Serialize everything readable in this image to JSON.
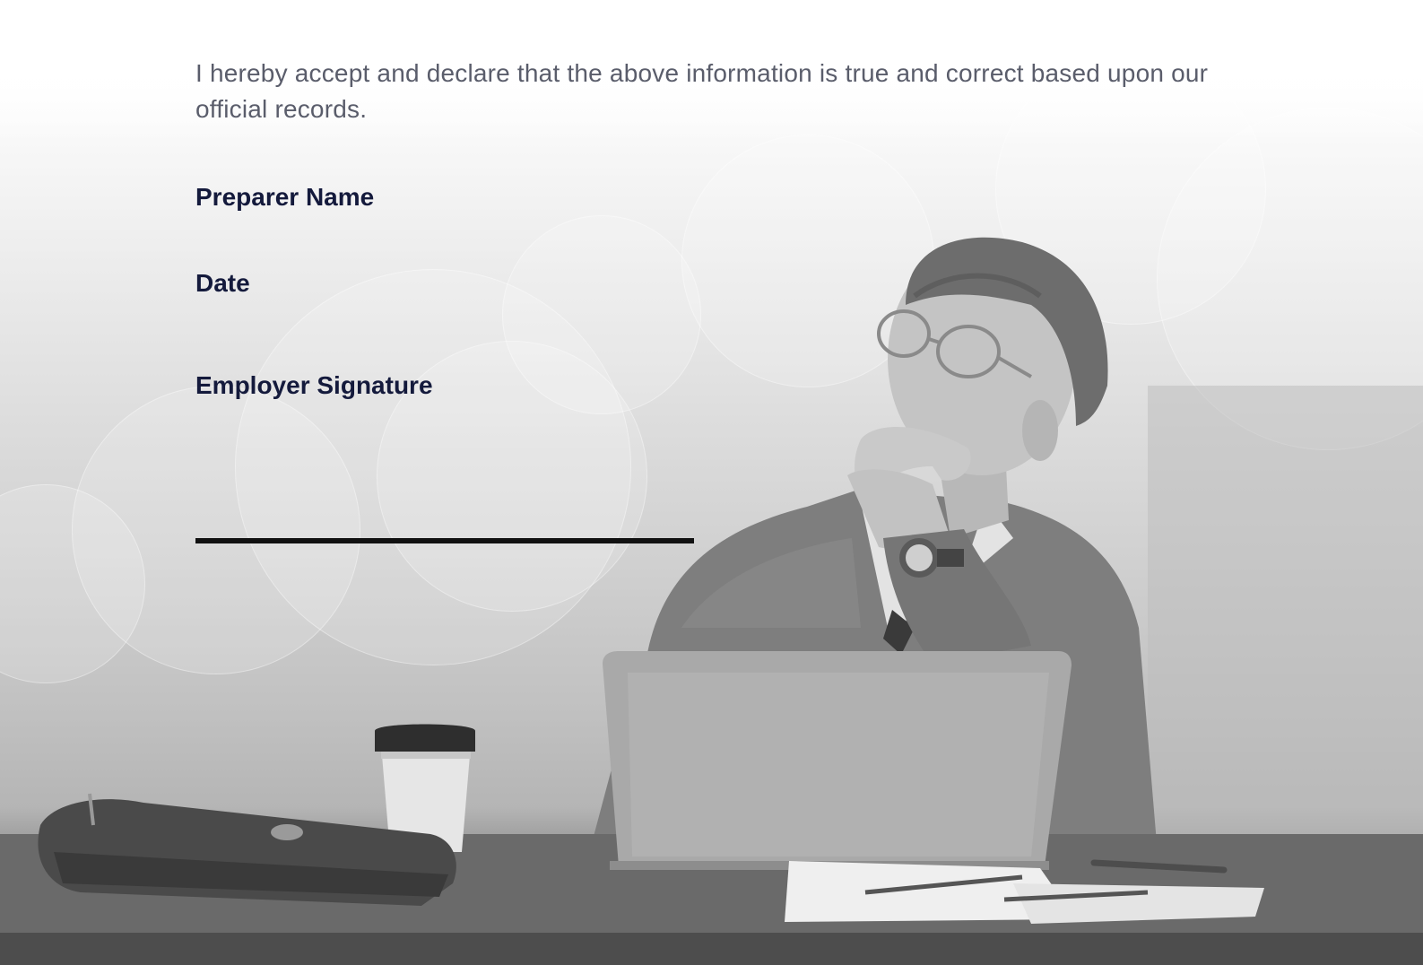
{
  "declaration": {
    "text": "I hereby accept and declare that the above information is true and correct based upon our official records."
  },
  "fields": {
    "preparer_name_label": "Preparer Name",
    "date_label": "Date",
    "employer_signature_label": "Employer Signature"
  },
  "background_photo": {
    "icon": "thinking-man-at-laptop-photo",
    "tone": "grayscale"
  },
  "colors": {
    "body_text": "#5a5d6b",
    "label_text": "#141a3c",
    "signature_line": "#111111"
  }
}
